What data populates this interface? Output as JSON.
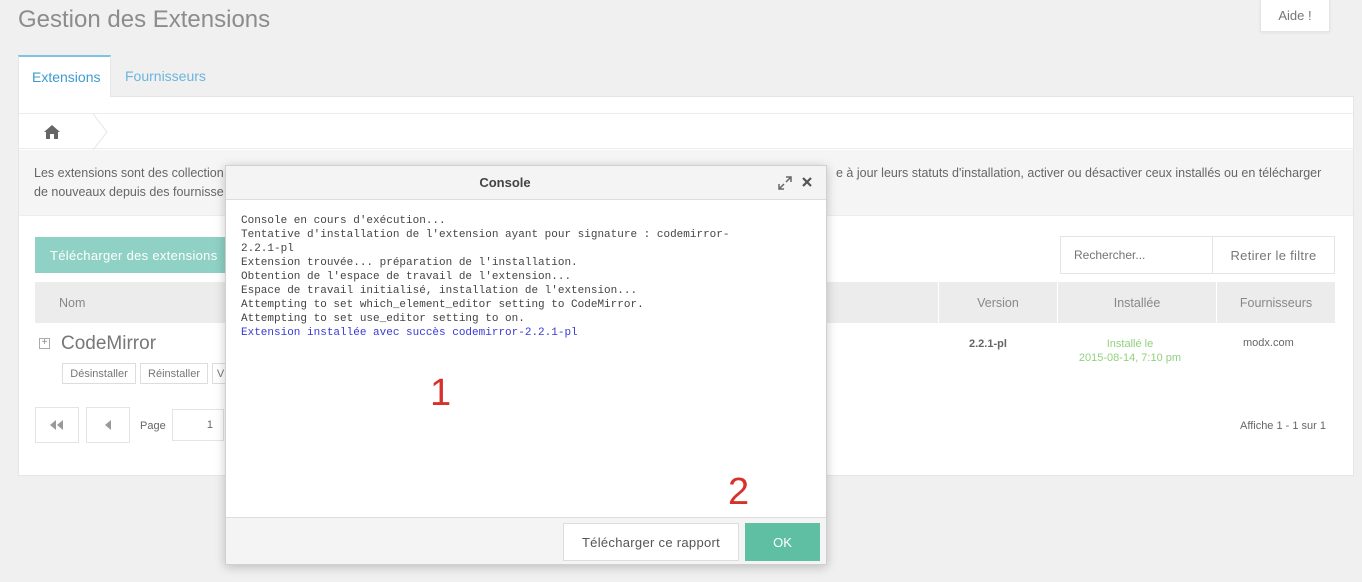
{
  "header": {
    "title": "Gestion des Extensions",
    "help_label": "Aide !"
  },
  "tabs": [
    {
      "label": "Extensions",
      "active": true
    },
    {
      "label": "Fournisseurs",
      "active": false
    }
  ],
  "breadcrumb": {
    "home_icon": "home-icon"
  },
  "description": {
    "left": "Les extensions sont des collection de nouveaux depuis des fournisse",
    "left_line1": "Les extensions sont des collection",
    "left_line2": "de nouveaux depuis des fournisse",
    "right_line1": "e à jour leurs statuts d'installation, activer ou désactiver ceux installés ou en télécharger"
  },
  "toolbar": {
    "download_label": "Télécharger des extensions",
    "search_placeholder": "Rechercher...",
    "clear_filter_label": "Retirer le filtre"
  },
  "grid": {
    "columns": [
      "Nom",
      "Version",
      "Installée",
      "Fournisseurs"
    ],
    "rows": [
      {
        "name": "CodeMirror",
        "version": "2.2.1-pl",
        "installed_line1": "Installé le",
        "installed_line2": "2015-08-14, 7:10 pm",
        "provider": "modx.com",
        "actions": [
          "Désinstaller",
          "Réinstaller",
          "V"
        ]
      }
    ]
  },
  "pagination": {
    "page_label": "Page",
    "page_value": "1",
    "info": "Affiche 1 - 1 sur 1"
  },
  "console": {
    "title": "Console",
    "lines": [
      "Console en cours d'exécution...",
      "Tentative d'installation de l'extension ayant pour signature : codemirror-",
      "2.2.1-pl",
      "Extension trouvée... préparation de l'installation.",
      "Obtention de l'espace de travail de l'extension...",
      "Espace de travail initialisé, installation de l'extension...",
      "Attempting to set which_element_editor setting to CodeMirror.",
      "Attempting to set use_editor setting to on."
    ],
    "success_line": "Extension installée avec succès codemirror-2.2.1-pl",
    "annotation_1": "1",
    "annotation_2": "2",
    "report_label": "Télécharger ce rapport",
    "ok_label": "OK"
  },
  "colors": {
    "accent": "#8fd1c5",
    "ok": "#5fbfa3",
    "tab_blue": "#3e9bd1",
    "installed_green": "#92d080",
    "annotation_red": "#d8312c"
  }
}
